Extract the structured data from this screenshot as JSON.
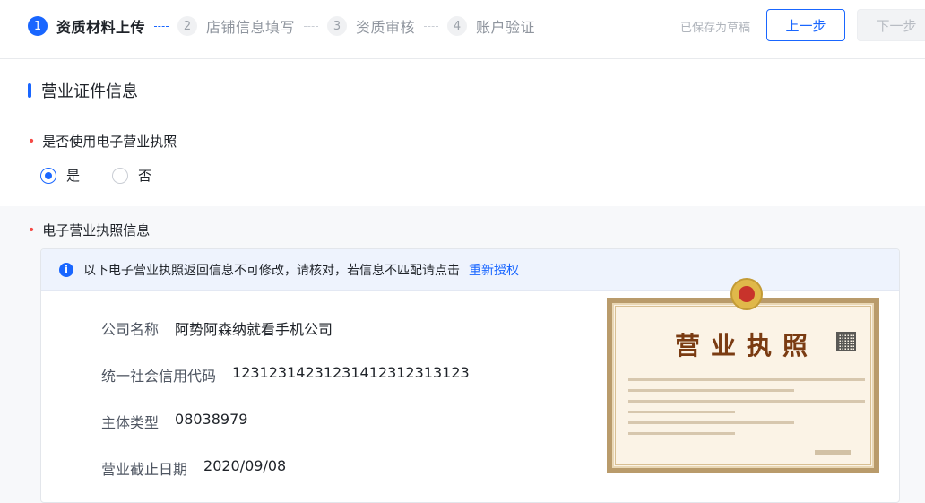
{
  "steps": [
    {
      "num": "1",
      "label": "资质材料上传",
      "active": true
    },
    {
      "num": "2",
      "label": "店铺信息填写",
      "active": false
    },
    {
      "num": "3",
      "label": "资质审核",
      "active": false
    },
    {
      "num": "4",
      "label": "账户验证",
      "active": false
    }
  ],
  "header": {
    "draft_status": "已保存为草稿",
    "prev_label": "上一步",
    "next_label": "下一步"
  },
  "section": {
    "title": "营业证件信息"
  },
  "use_e_license": {
    "required_mark": "•",
    "label": "是否使用电子营业执照",
    "options": [
      {
        "label": "是",
        "checked": true
      },
      {
        "label": "否",
        "checked": false
      }
    ]
  },
  "e_license_info": {
    "required_mark": "•",
    "label": "电子营业执照信息",
    "notice_icon": "i",
    "notice_text": "以下电子营业执照返回信息不可修改，请核对，若信息不匹配请点击",
    "notice_link": "重新授权",
    "fields": [
      {
        "key": "公司名称",
        "value": "阿势阿森纳就看手机公司"
      },
      {
        "key": "统一社会信用代码",
        "value": "1231231423123141231231312​3"
      },
      {
        "key": "主体类型",
        "value": "08038979"
      },
      {
        "key": "营业截止日期",
        "value": "2020/09/08"
      }
    ],
    "license_image": {
      "title": "营业执照"
    }
  },
  "colors": {
    "primary": "#1966ff",
    "required": "#f54a45",
    "notice_bg": "#eef3fd"
  }
}
